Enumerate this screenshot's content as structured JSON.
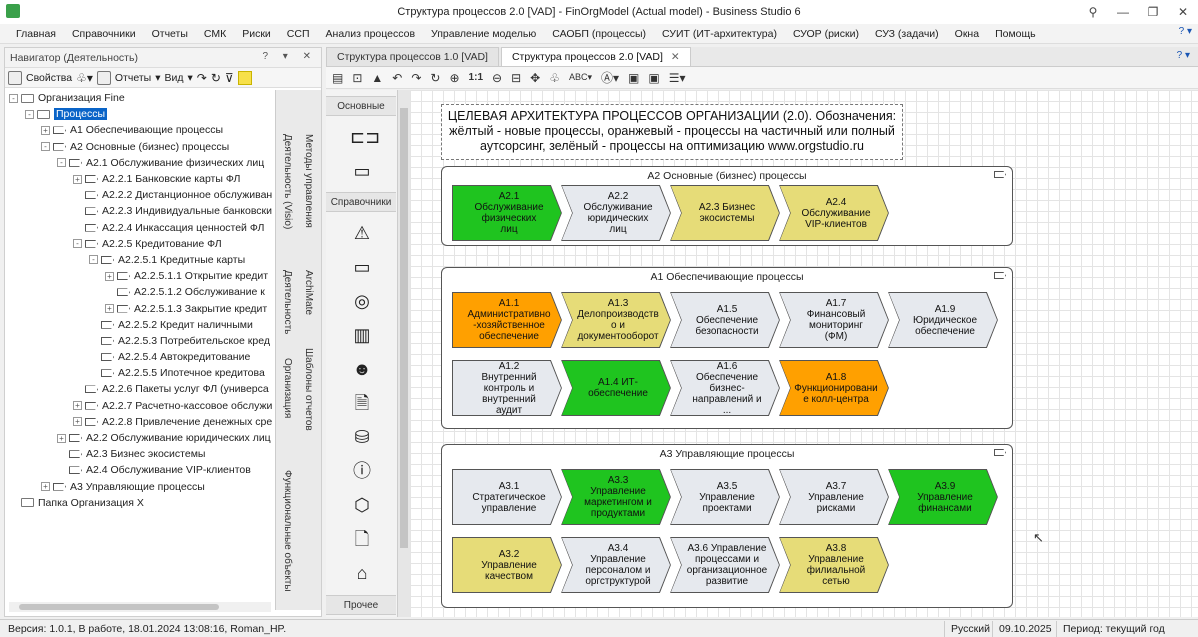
{
  "window": {
    "title": "Структура процессов 2.0 [VAD] - FinOrgModel (Actual model) - Business Studio 6"
  },
  "menu": [
    "Главная",
    "Справочники",
    "Отчеты",
    "СМК",
    "Риски",
    "ССП",
    "Анализ процессов",
    "Управление моделью",
    "САОБП (процессы)",
    "СУИТ (ИТ-архитектура)",
    "СУОР (риски)",
    "СУЗ (задачи)",
    "Окна",
    "Помощь"
  ],
  "menu_help": "? ▾",
  "navigator": {
    "title": "Навигатор (Деятельность)",
    "toolbar": {
      "properties": "Свойства",
      "reports": "Отчеты",
      "view": "Вид"
    },
    "tree": [
      {
        "label": "Организация Fine",
        "level": 0,
        "icon": "folder",
        "exp": "-"
      },
      {
        "label": "Процессы",
        "level": 1,
        "icon": "folder",
        "exp": "-",
        "selected": true
      },
      {
        "label": "A1 Обеспечивающие процессы",
        "level": 2,
        "icon": "process",
        "exp": "+"
      },
      {
        "label": "A2 Основные (бизнес) процессы",
        "level": 2,
        "icon": "process",
        "exp": "-"
      },
      {
        "label": "A2.1 Обслуживание физических лиц",
        "level": 3,
        "icon": "process",
        "exp": "-"
      },
      {
        "label": "A2.2.1 Банковские карты ФЛ",
        "level": 4,
        "icon": "process",
        "exp": "+"
      },
      {
        "label": "A2.2.2 Дистанционное обслуживан",
        "level": 4,
        "icon": "process",
        "exp": ""
      },
      {
        "label": "A2.2.3 Индивидуальные банковски",
        "level": 4,
        "icon": "process",
        "exp": ""
      },
      {
        "label": "A2.2.4 Инкассация ценностей ФЛ",
        "level": 4,
        "icon": "process",
        "exp": ""
      },
      {
        "label": "A2.2.5 Кредитование ФЛ",
        "level": 4,
        "icon": "process",
        "exp": "-"
      },
      {
        "label": "A2.2.5.1 Кредитные карты",
        "level": 5,
        "icon": "process",
        "exp": "-"
      },
      {
        "label": "A2.2.5.1.1 Открытие кредит",
        "level": 6,
        "icon": "process",
        "exp": "+"
      },
      {
        "label": "A2.2.5.1.2 Обслуживание к",
        "level": 6,
        "icon": "process",
        "exp": ""
      },
      {
        "label": "A2.2.5.1.3 Закрытие кредит",
        "level": 6,
        "icon": "process",
        "exp": "+"
      },
      {
        "label": "A2.2.5.2 Кредит наличными",
        "level": 5,
        "icon": "process",
        "exp": ""
      },
      {
        "label": "A2.2.5.3 Потребительское кред",
        "level": 5,
        "icon": "process",
        "exp": ""
      },
      {
        "label": "A2.2.5.4 Автокредитование",
        "level": 5,
        "icon": "process",
        "exp": ""
      },
      {
        "label": "A2.2.5.5 Ипотечное кредитова",
        "level": 5,
        "icon": "process",
        "exp": ""
      },
      {
        "label": "A2.2.6 Пакеты услуг ФЛ (универса",
        "level": 4,
        "icon": "process",
        "exp": ""
      },
      {
        "label": "A2.2.7 Расчетно-кассовое обслужи",
        "level": 4,
        "icon": "process",
        "exp": "+"
      },
      {
        "label": "A2.2.8 Привлечение денежных сре",
        "level": 4,
        "icon": "process",
        "exp": "+"
      },
      {
        "label": "A2.2 Обслуживание юридических лиц",
        "level": 3,
        "icon": "process",
        "exp": "+"
      },
      {
        "label": "A2.3 Бизнес экосистемы",
        "level": 3,
        "icon": "process",
        "exp": ""
      },
      {
        "label": "A2.4 Обслуживание VIP-клиентов",
        "level": 3,
        "icon": "process",
        "exp": ""
      },
      {
        "label": "A3 Управляющие процессы",
        "level": 2,
        "icon": "process",
        "exp": "+"
      },
      {
        "label": "Папка Организация X",
        "level": 0,
        "icon": "folder",
        "exp": ""
      }
    ],
    "side_tabs": [
      "Деятельность (Visio)",
      "Деятельность",
      "Организация",
      "Функциональные объекты",
      "Методы управления",
      "ArchiMate",
      "Шаблоны отчетов"
    ]
  },
  "doc_tabs": [
    {
      "label": "Структура процессов 1.0 [VAD]",
      "active": false
    },
    {
      "label": "Структура процессов 2.0 [VAD]",
      "active": true
    }
  ],
  "palette": {
    "sections": [
      "Основные",
      "Справочники",
      "Прочее"
    ]
  },
  "diagram": {
    "note": [
      "ЦЕЛЕВАЯ АРХИТЕКТУРА ПРОЦЕССОВ ОРГАНИЗАЦИИ (2.0). Обозначения:",
      "жёлтый - новые процессы, оранжевый - процессы на частичный или полный",
      "аутсорсинг, зелёный - процессы на оптимизацию www.orgstudio.ru"
    ],
    "colors": {
      "green": "#1fc41f",
      "orange": "#ffa000",
      "yellow": "#e6dc78",
      "grey": "#e6e9ee"
    },
    "groups": [
      {
        "title": "A2 Основные (бизнес) процессы",
        "processes": [
          {
            "label": "A2.1 Обслуживание физических лиц",
            "color": "green"
          },
          {
            "label": "A2.2 Обслуживание юридических лиц",
            "color": "grey"
          },
          {
            "label": "A2.3 Бизнес экосистемы",
            "color": "yellow"
          },
          {
            "label": "A2.4 Обслуживание VIP-клиентов",
            "color": "yellow"
          }
        ]
      },
      {
        "title": "A1 Обеспечивающие процессы",
        "processes": [
          {
            "label": "A1.1 Административно -хозяйственное обеспечение",
            "color": "orange"
          },
          {
            "label": "A1.3 Делопроизводств о и документооборот",
            "color": "yellow"
          },
          {
            "label": "A1.5 Обеспечение безопасности",
            "color": "grey"
          },
          {
            "label": "A1.7 Финансовый мониторинг (ФМ)",
            "color": "grey"
          },
          {
            "label": "A1.9 Юридическое обеспечение",
            "color": "grey"
          },
          {
            "label": "A1.2 Внутренний контроль и внутренний аудит",
            "color": "grey"
          },
          {
            "label": "A1.4 ИТ-обеспечение",
            "color": "green"
          },
          {
            "label": "A1.6 Обеспечение бизнес-направлений и ...",
            "color": "grey"
          },
          {
            "label": "A1.8 Функционировани е колл-центра",
            "color": "orange"
          }
        ]
      },
      {
        "title": "A3 Управляющие процессы",
        "processes": [
          {
            "label": "A3.1 Стратегическое управление",
            "color": "grey"
          },
          {
            "label": "A3.3 Управление маркетингом и продуктами",
            "color": "green"
          },
          {
            "label": "A3.5 Управление проектами",
            "color": "grey"
          },
          {
            "label": "A3.7 Управление рисками",
            "color": "grey"
          },
          {
            "label": "A3.9 Управление финансами",
            "color": "green"
          },
          {
            "label": "A3.2 Управление качеством",
            "color": "yellow"
          },
          {
            "label": "A3.4 Управление персоналом и оргструктурой",
            "color": "grey"
          },
          {
            "label": "A3.6 Управление процессами и организационное развитие",
            "color": "grey"
          },
          {
            "label": "A3.8 Управление филиальной сетью",
            "color": "yellow"
          }
        ]
      }
    ]
  },
  "status": {
    "version": "Версия: 1.0.1, В работе, 18.01.2024 13:08:16, Roman_HP.",
    "language": "Русский",
    "date": "09.10.2025",
    "period": "Период: текущий год"
  }
}
